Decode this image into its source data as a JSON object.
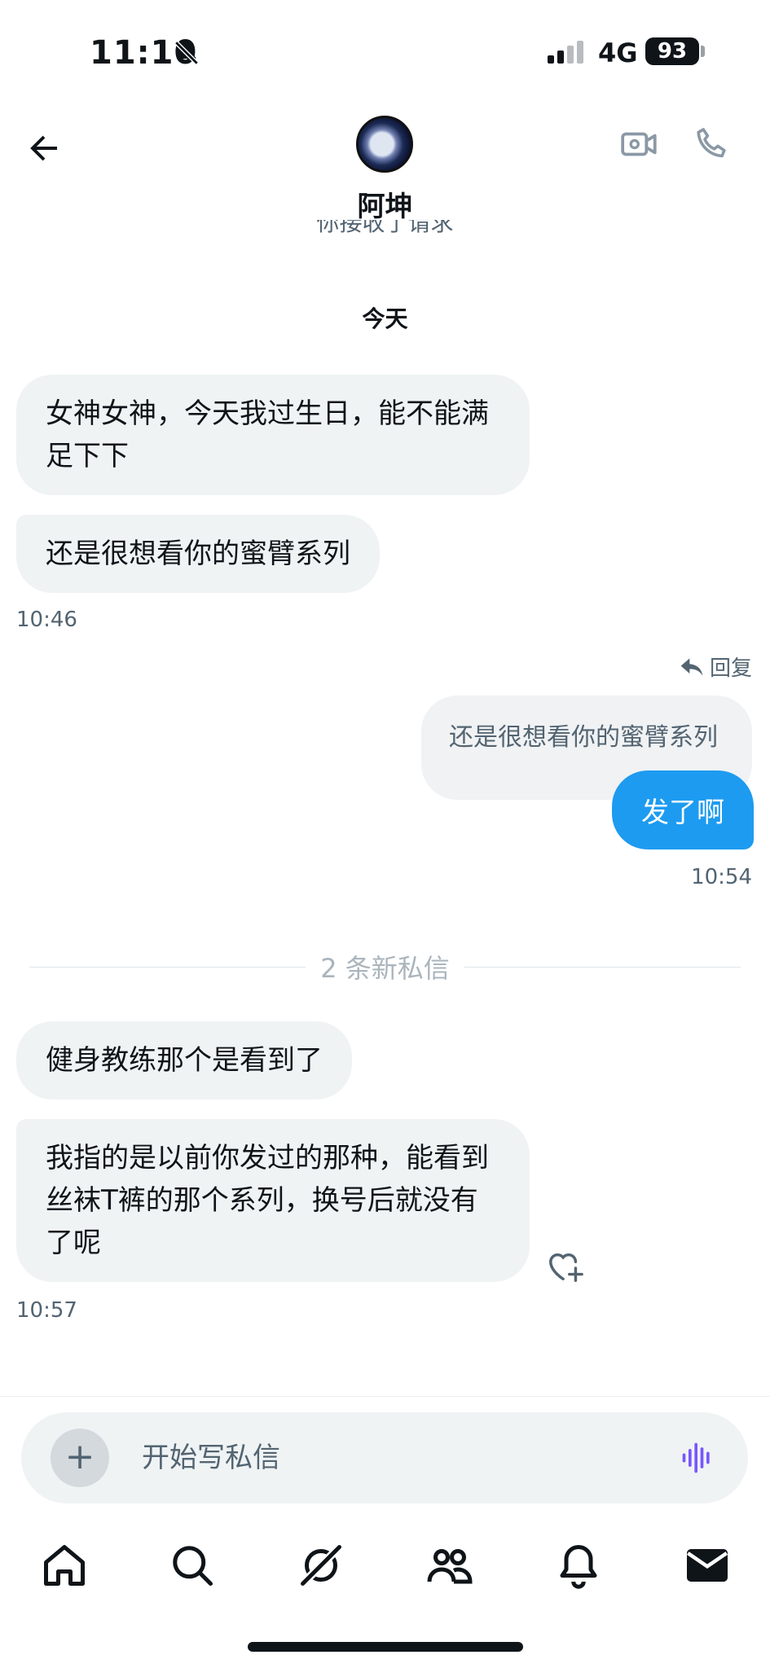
{
  "status_bar": {
    "time": "11:10",
    "network": "4G",
    "battery": "93",
    "icons": [
      "bell-slash-icon",
      "signal-icon"
    ]
  },
  "header": {
    "contact_name": "阿坤",
    "clipped_note": "你接收了请求",
    "icons": [
      "back-arrow-icon",
      "video-call-icon",
      "phone-icon"
    ]
  },
  "conversation": {
    "date_separator": "今天",
    "incoming_group_1": [
      {
        "text": "女神女神，今天我过生日，能不能满足下下"
      },
      {
        "text": "还是很想看你的蜜臂系列"
      }
    ],
    "incoming_group_1_time": "10:46",
    "reply": {
      "label": "回复",
      "quoted_text": "还是很想看你的蜜臂系列",
      "text": "发了啊",
      "time": "10:54"
    },
    "new_messages_divider": "2 条新私信",
    "incoming_group_2": [
      {
        "text": "健身教练那个是看到了"
      },
      {
        "text": "我指的是以前你发过的那种，能看到丝袜T裤的那个系列，换号后就没有了呢"
      }
    ],
    "incoming_group_2_time": "10:57"
  },
  "composer": {
    "placeholder": "开始写私信",
    "value": ""
  },
  "bottom_nav": [
    "home-icon",
    "search-icon",
    "grok-icon",
    "communities-icon",
    "notifications-icon",
    "messages-icon"
  ],
  "colors": {
    "accent": "#1d9bf0",
    "bubble_incoming": "#eff3f4",
    "text_secondary": "#536471",
    "voice_accent": "#7856ff"
  }
}
